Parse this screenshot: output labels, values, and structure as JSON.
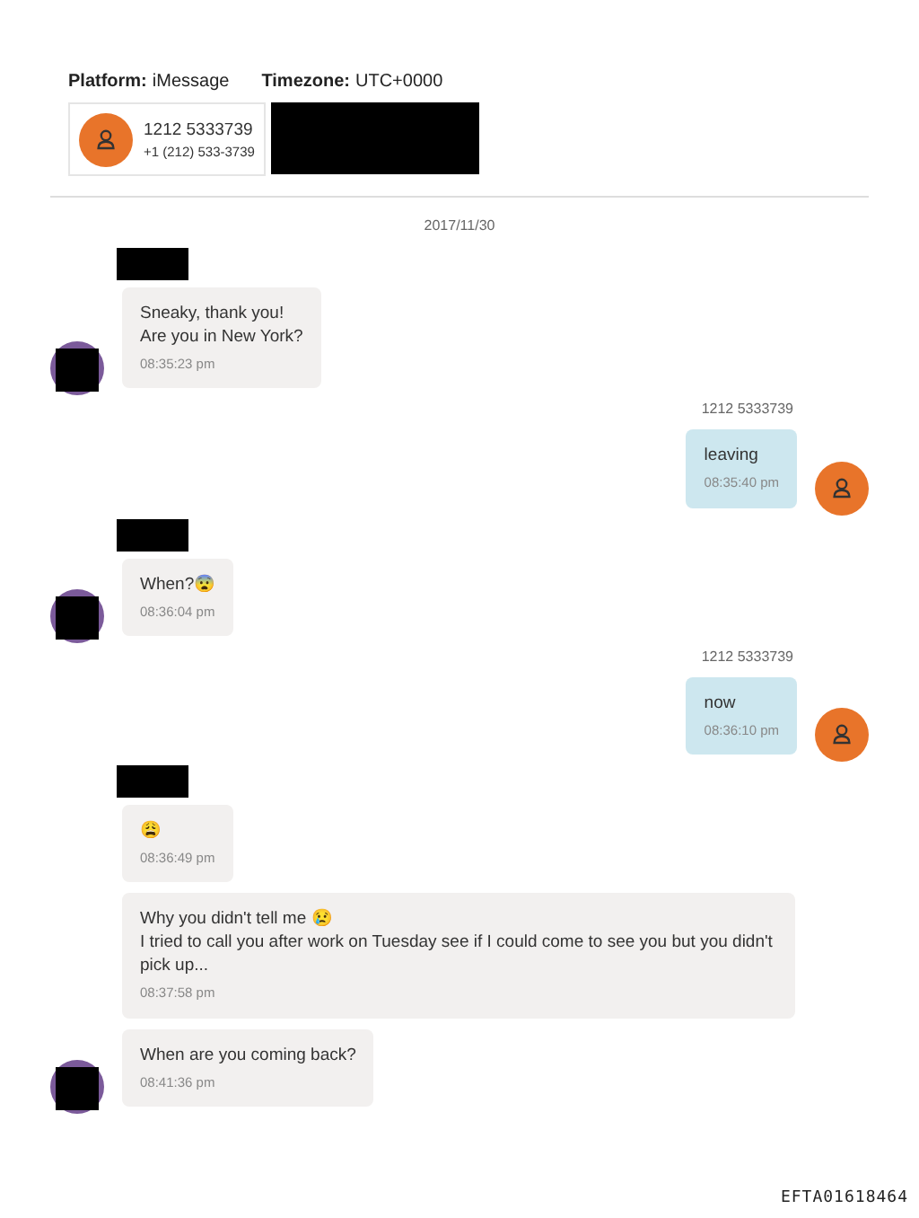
{
  "header": {
    "platform_label": "Platform:",
    "platform": "iMessage",
    "timezone_label": "Timezone:",
    "timezone": "UTC+0000"
  },
  "contact": {
    "name": "1212 5333739",
    "phone": "+1 (212) 533-3739",
    "details_redacted": true
  },
  "date": "2017/11/30",
  "messages": [
    {
      "kind": "incoming",
      "sender_redacted": true,
      "avatar": true,
      "text": "Sneaky, thank you!\nAre you in New York?",
      "time": "08:35:23 pm"
    },
    {
      "kind": "outgoing",
      "sender": "1212 5333739",
      "avatar": true,
      "text": "leaving",
      "time": "08:35:40 pm"
    },
    {
      "kind": "incoming",
      "sender_redacted": true,
      "avatar": true,
      "text": "When?😨",
      "time": "08:36:04 pm"
    },
    {
      "kind": "outgoing",
      "sender": "1212 5333739",
      "avatar": true,
      "text": "now",
      "time": "08:36:10 pm"
    },
    {
      "kind": "incoming",
      "sender_redacted": true,
      "avatar": false,
      "text": "😩",
      "time": "08:36:49 pm"
    },
    {
      "kind": "incoming",
      "sender_redacted": false,
      "avatar": false,
      "text": "Why you didn't tell me 😢\nI tried to call you after work on Tuesday see if I could come to see you but you didn't pick up...",
      "time": "08:37:58 pm"
    },
    {
      "kind": "incoming",
      "sender_redacted": false,
      "avatar": true,
      "text": "When are you coming back?",
      "time": "08:41:36 pm"
    }
  ],
  "footer_stamp": "EFTA01618464"
}
